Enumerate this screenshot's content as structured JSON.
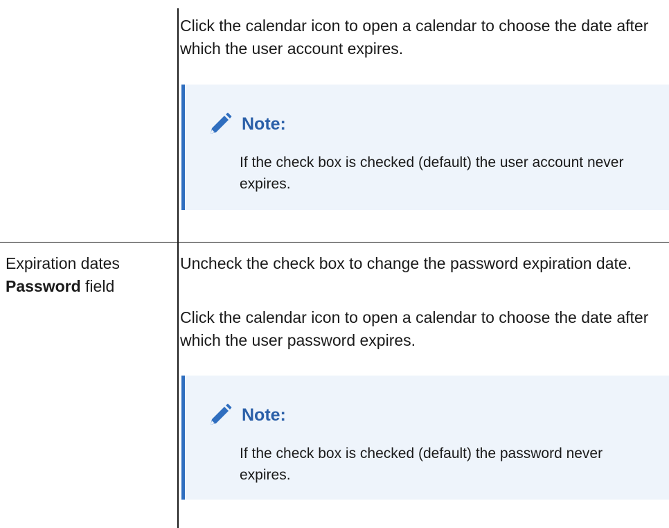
{
  "row1": {
    "description": "Click the calendar icon to open a calendar to choose the date after which the user account expires.",
    "note": {
      "icon": "pencil-icon",
      "title": "Note:",
      "body": "If the check box is checked (default) the user account never expires."
    }
  },
  "row2": {
    "term_prefix": "Expiration dates",
    "term_bold": "Password",
    "term_suffix": "field",
    "paragraph1": "Uncheck the check box to change the password expiration date.",
    "paragraph2": "Click the calendar icon to open a calendar to choose the date after which the user password expires.",
    "note": {
      "icon": "pencil-icon",
      "title": "Note:",
      "body": "If the check box is checked (default) the password never expires."
    }
  },
  "colors": {
    "note_background": "#eef4fb",
    "note_accent": "#2f6ebf",
    "note_title": "#2a5fa8"
  }
}
